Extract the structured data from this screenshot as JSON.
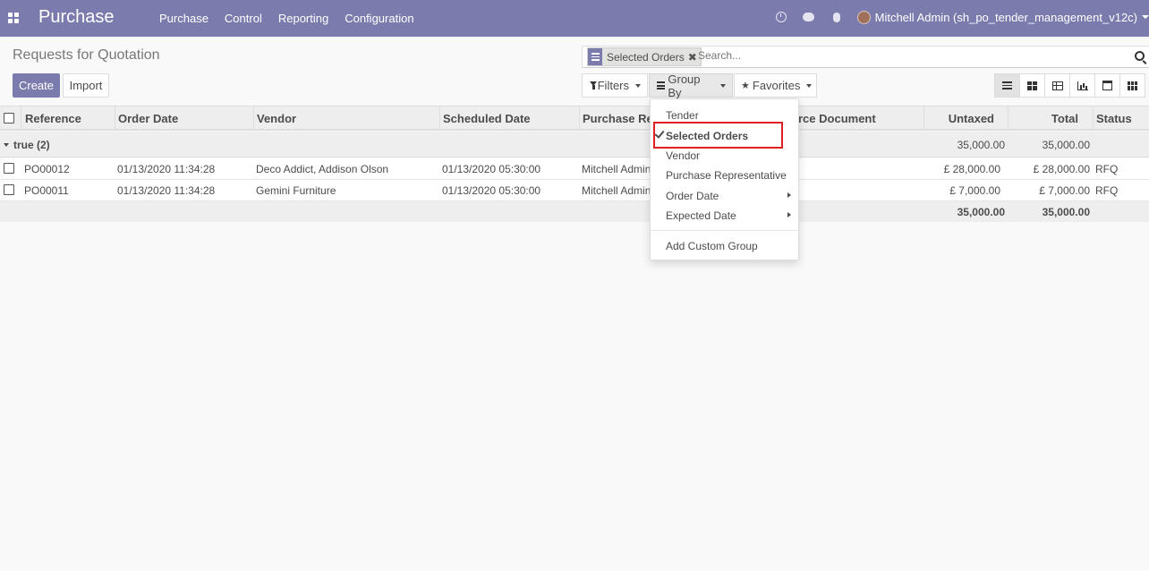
{
  "navbar": {
    "brand": "Purchase",
    "menu": [
      "Purchase",
      "Control",
      "Reporting",
      "Configuration"
    ],
    "user": "Mitchell Admin (sh_po_tender_management_v12c)",
    "icons": [
      "clock-icon",
      "chat-icon",
      "bug-icon"
    ]
  },
  "control_panel": {
    "breadcrumb": "Requests for Quotation",
    "create_label": "Create",
    "import_label": "Import",
    "filters_label": "Filters",
    "groupby_label": "Group By",
    "favorites_label": "Favorites"
  },
  "search": {
    "facet": "Selected Orders",
    "placeholder": "Search..."
  },
  "table": {
    "columns": [
      "Reference",
      "Order Date",
      "Vendor",
      "Scheduled Date",
      "Purchase Rep",
      "rce Document",
      "Untaxed",
      "Total",
      "Status"
    ],
    "group": {
      "label": "true (2)",
      "untaxed": "35,000.00",
      "total": "35,000.00"
    },
    "rows": [
      {
        "reference": "PO00012",
        "order_date": "01/13/2020 11:34:28",
        "vendor": "Deco Addict, Addison Olson",
        "scheduled_date": "01/13/2020 05:30:00",
        "rep": "Mitchell Admin",
        "untaxed": "£ 28,000.00",
        "total": "£ 28,000.00",
        "status": "RFQ"
      },
      {
        "reference": "PO00011",
        "order_date": "01/13/2020 11:34:28",
        "vendor": "Gemini Furniture",
        "scheduled_date": "01/13/2020 05:30:00",
        "rep": "Mitchell Admin",
        "untaxed": "£ 7,000.00",
        "total": "£ 7,000.00",
        "status": "RFQ"
      }
    ],
    "footer": {
      "untaxed": "35,000.00",
      "total": "35,000.00"
    }
  },
  "groupby_menu": {
    "items": [
      "Tender",
      "Selected Orders",
      "Vendor",
      "Purchase Representative",
      "Order Date",
      "Expected Date"
    ],
    "selected": "Selected Orders",
    "custom": "Add Custom Group"
  },
  "colors": {
    "brand": "#7c7bad",
    "highlight": "#e02020"
  }
}
